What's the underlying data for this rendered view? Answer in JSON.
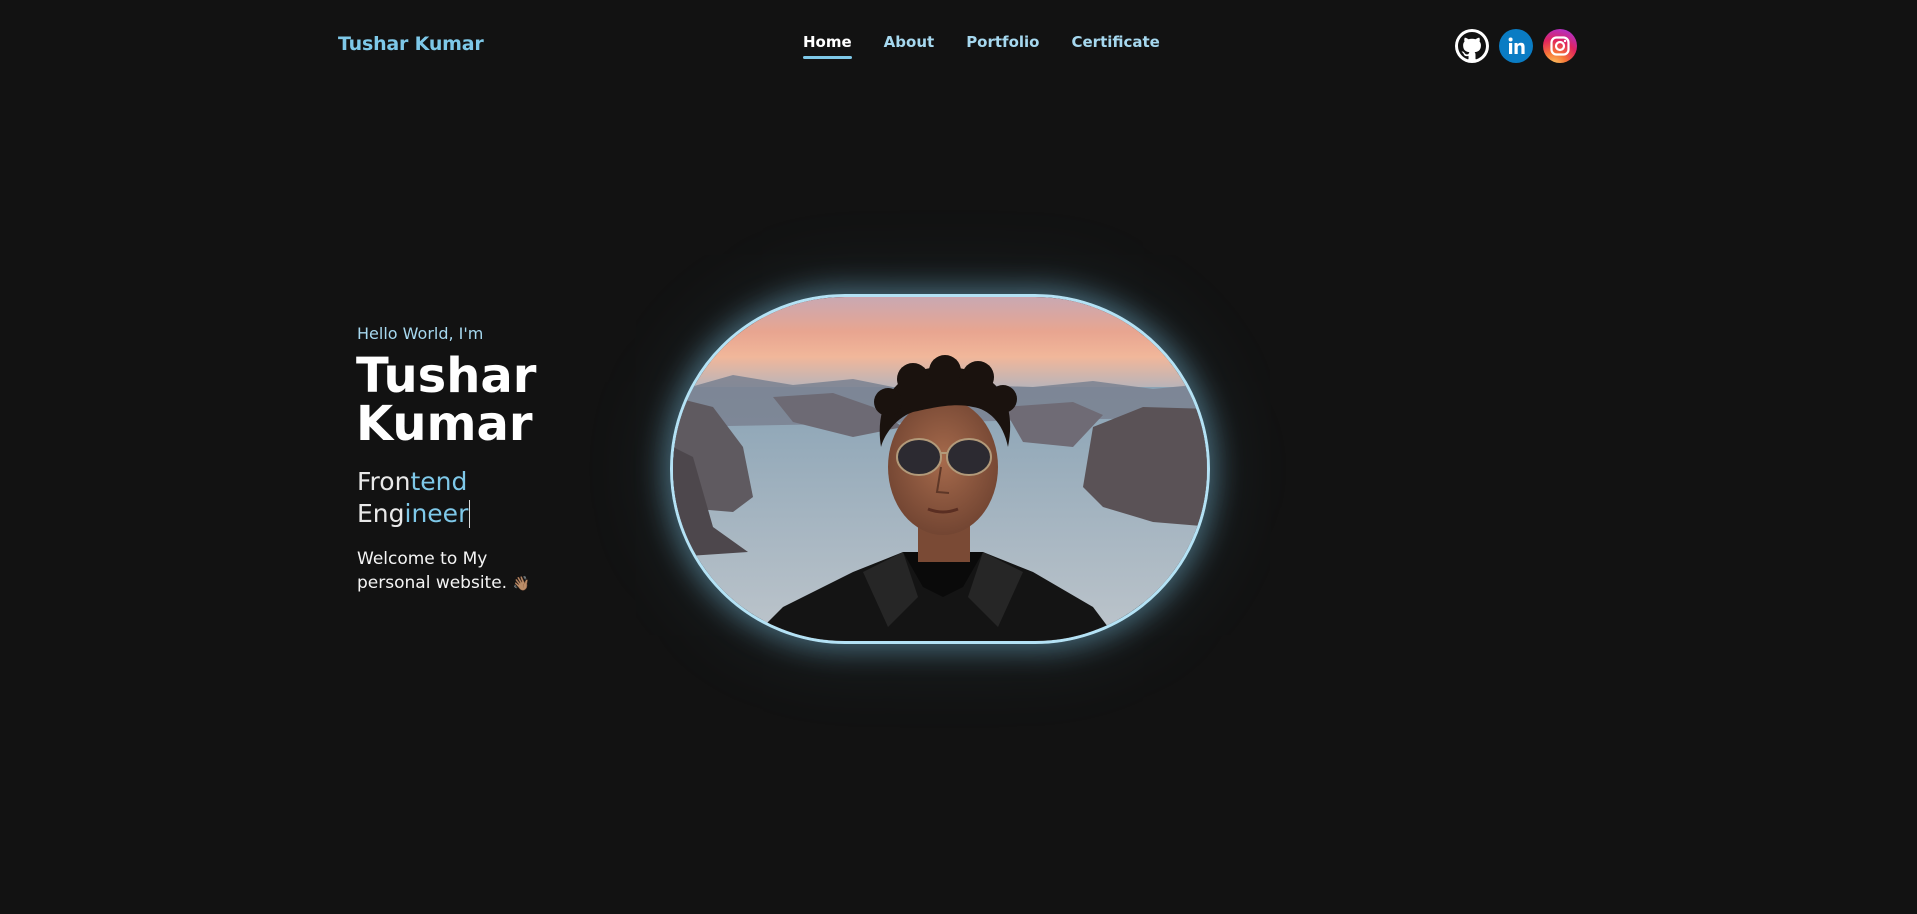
{
  "header": {
    "brand": "Tushar Kumar",
    "nav": [
      {
        "label": "Home",
        "active": true
      },
      {
        "label": "About",
        "active": false
      },
      {
        "label": "Portfolio",
        "active": false
      },
      {
        "label": "Certificate",
        "active": false
      }
    ],
    "socials": [
      {
        "name": "github-icon",
        "color": "#ffffff"
      },
      {
        "name": "linkedin-icon",
        "color": "#0a7cc4",
        "glyph": "in"
      },
      {
        "name": "instagram-icon",
        "color": "#e0245e"
      }
    ]
  },
  "hero": {
    "greeting": "Hello World, I'm",
    "name_line1": "Tushar",
    "name_line2": "Kumar",
    "role_plain": "Fron",
    "role_highlight": "tend",
    "role_line2_plain": "Eng",
    "role_line2_highlight": "ineer",
    "welcome": "Welcome to My personal website.",
    "emoji": "👋🏽"
  },
  "theme": {
    "background": "#121212",
    "accent": "#7ec8e8",
    "text": "#ffffff"
  }
}
